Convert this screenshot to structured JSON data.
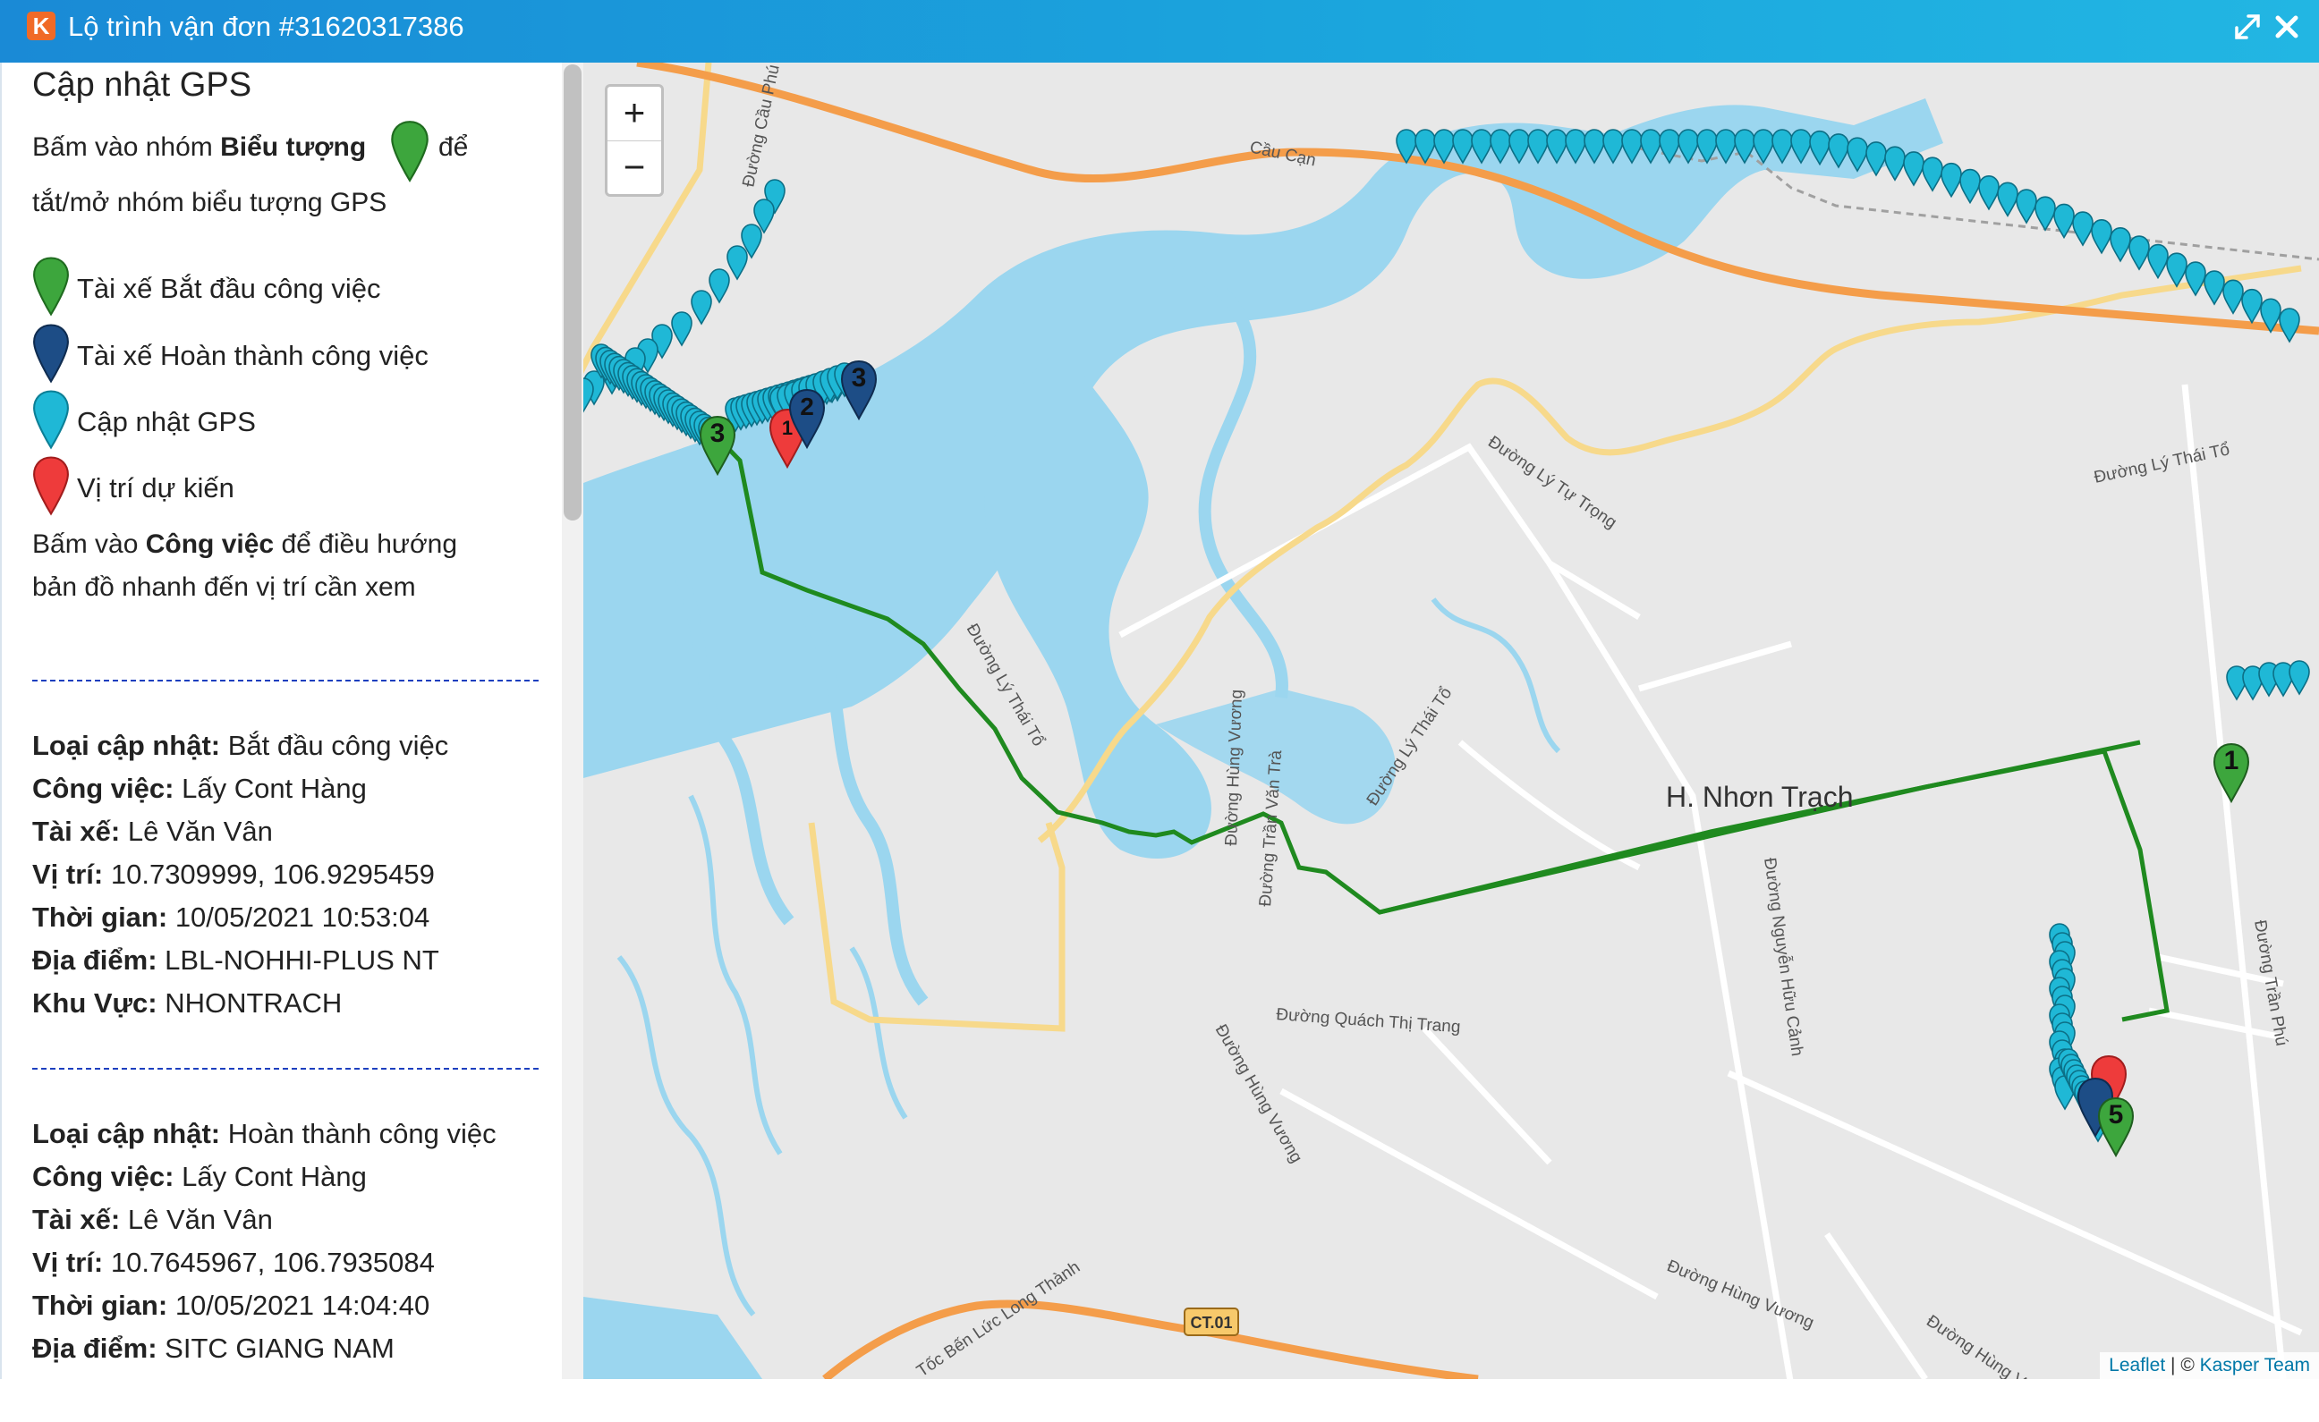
{
  "window": {
    "logo": "K",
    "title": "Lộ trình vận đơn #31620317386",
    "expand_icon": "expand-icon",
    "close_icon": "close-icon"
  },
  "sidebar": {
    "heading": "Cập nhật GPS",
    "intro_pre": "Bấm vào nhóm ",
    "intro_bold": "Biểu tượng",
    "intro_post": "để",
    "intro_line2": "tắt/mở nhóm biểu tượng GPS",
    "legend": [
      {
        "label": "Tài xế Bắt đầu công việc",
        "color": "#3da63d"
      },
      {
        "label": "Tài xế Hoàn thành công việc",
        "color": "#1d4d86"
      },
      {
        "label": "Cập nhật GPS",
        "color": "#1fb8d6"
      },
      {
        "label": "Vị trí dự kiến",
        "color": "#ee3b3b"
      }
    ],
    "hint_pre": "Bấm vào ",
    "hint_bold": "Công việc",
    "hint_post": " để điều hướng",
    "hint_line2": "bản đồ nhanh đến vị trí cần xem",
    "updates": [
      {
        "type_label": "Loại cập nhật:",
        "type": "Bắt đầu công việc",
        "job_label": "Công việc:",
        "job": "Lấy Cont Hàng",
        "driver_label": "Tài xế:",
        "driver": "Lê Văn Vân",
        "pos_label": "Vị trí:",
        "pos": "10.7309999, 106.9295459",
        "time_label": "Thời gian:",
        "time": "10/05/2021 10:53:04",
        "place_label": "Địa điểm:",
        "place": "LBL-NOHHI-PLUS NT",
        "area_label": "Khu Vực:",
        "area": "NHONTRACH"
      },
      {
        "type_label": "Loại cập nhật:",
        "type": "Hoàn thành công việc",
        "job_label": "Công việc:",
        "job": "Lấy Cont Hàng",
        "driver_label": "Tài xế:",
        "driver": "Lê Văn Vân",
        "pos_label": "Vị trí:",
        "pos": "10.7645967, 106.7935084",
        "time_label": "Thời gian:",
        "time": "10/05/2021 14:04:40",
        "place_label": "Địa điểm:",
        "place": "SITC GIANG NAM"
      }
    ]
  },
  "map": {
    "zoom_in": "+",
    "zoom_out": "−",
    "district_label": "H. Nhơn Trạch",
    "roads": {
      "cau_can": "Cầu Cạn",
      "ly_tu_trong": "Đường Lý Tự Trọng",
      "ly_thai_to_ne": "Đường Lý Thái Tổ",
      "ly_thai_to_w": "Đường Lý Thái Tổ",
      "ly_thai_to_mid": "Đường Lý Thái Tổ",
      "hung_vuong_1": "Đường Hùng Vương",
      "tran_van_tra": "Đường Trần Văn Trà",
      "quach_thi_trang": "Đường Quách Thị Trang",
      "hung_vuong_2": "Đường Hùng Vương",
      "nguyen_huu_canh": "Đường Nguyễn Hữu Cảnh",
      "tran_phu": "Đường Trần Phú",
      "hung_vuong_3": "Đường Hùng Vương",
      "hung_vuong_4": "Đường Hùng Vương",
      "ben_luc": "Tốc Bến Lức Long Thành",
      "ct01": "CT.01",
      "cau_phu": "Đường Cầu Phú"
    },
    "markers": {
      "m1": "1",
      "m2": "2",
      "m3": "3",
      "m5": "5",
      "red1": "1"
    },
    "attribution_leaflet": "Leaflet",
    "attribution_sep": " | © ",
    "attribution_team": "Kasper Team"
  }
}
